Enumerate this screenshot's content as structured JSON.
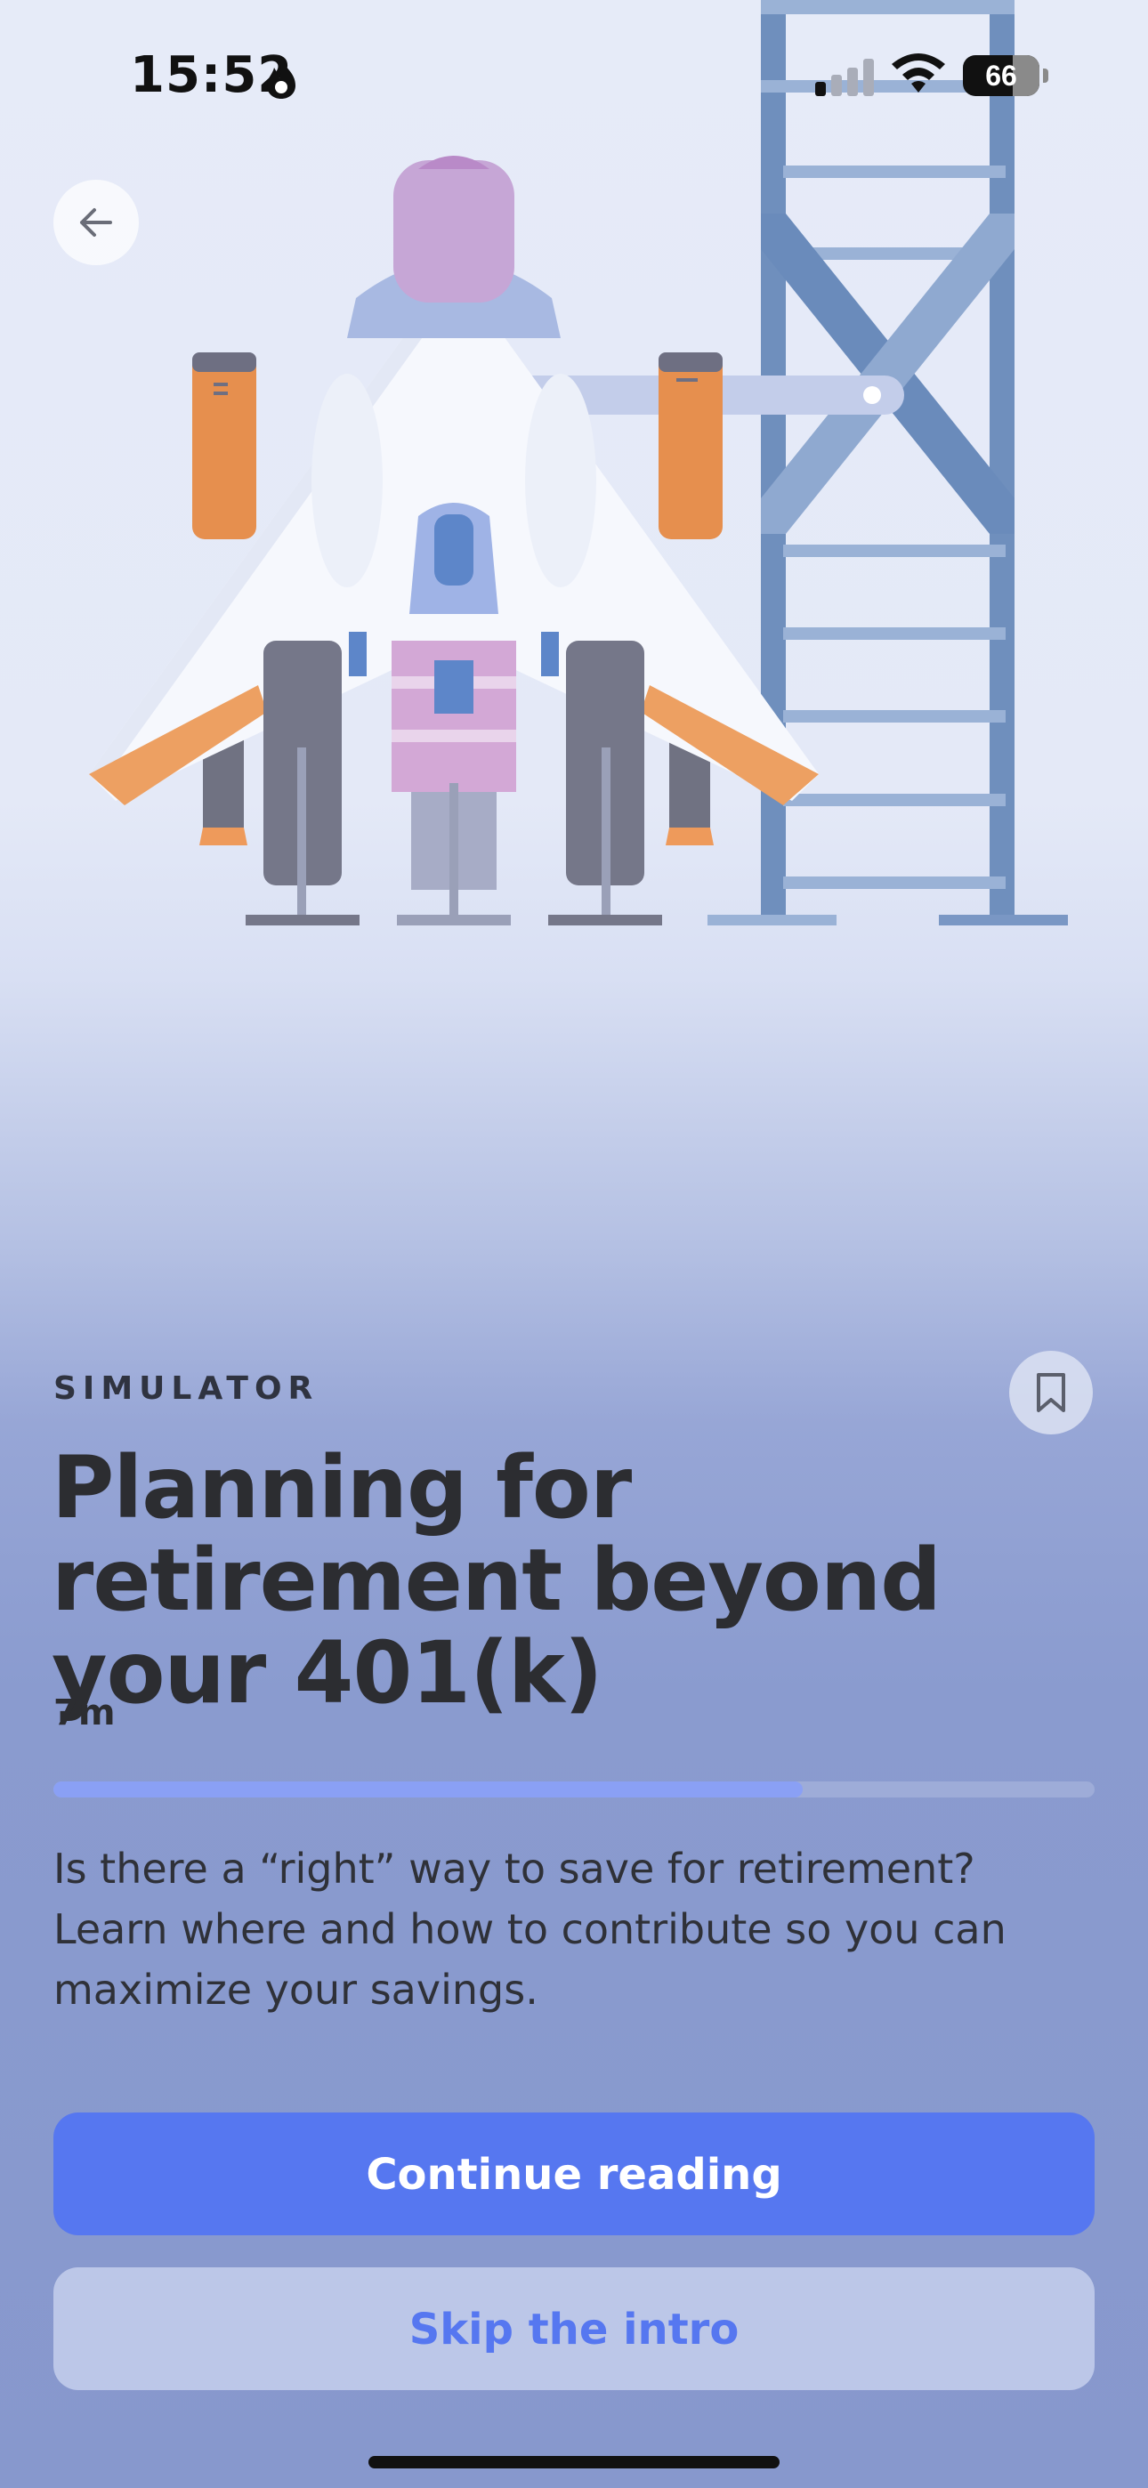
{
  "status_bar": {
    "time": "15:52",
    "battery": "66",
    "battery_level": 0.66
  },
  "navigation": {
    "back_icon": "arrow-left-icon"
  },
  "hero": {
    "illustration": "rocket-launch-illustration"
  },
  "article": {
    "category": "SIMULATOR",
    "title": "Planning for retirement beyond your 401(k)",
    "duration": "7m",
    "progress": 0.72,
    "description": "Is there a “right” way to save for retirement? Learn where and how to contribute so you can maximize your savings.",
    "bookmark_icon": "bookmark-icon"
  },
  "actions": {
    "continue_label": "Continue reading",
    "skip_label": "Skip the intro"
  },
  "colors": {
    "accent": "#5677f0",
    "progress_fill": "#8aa0f5",
    "title": "#2c2d31"
  }
}
